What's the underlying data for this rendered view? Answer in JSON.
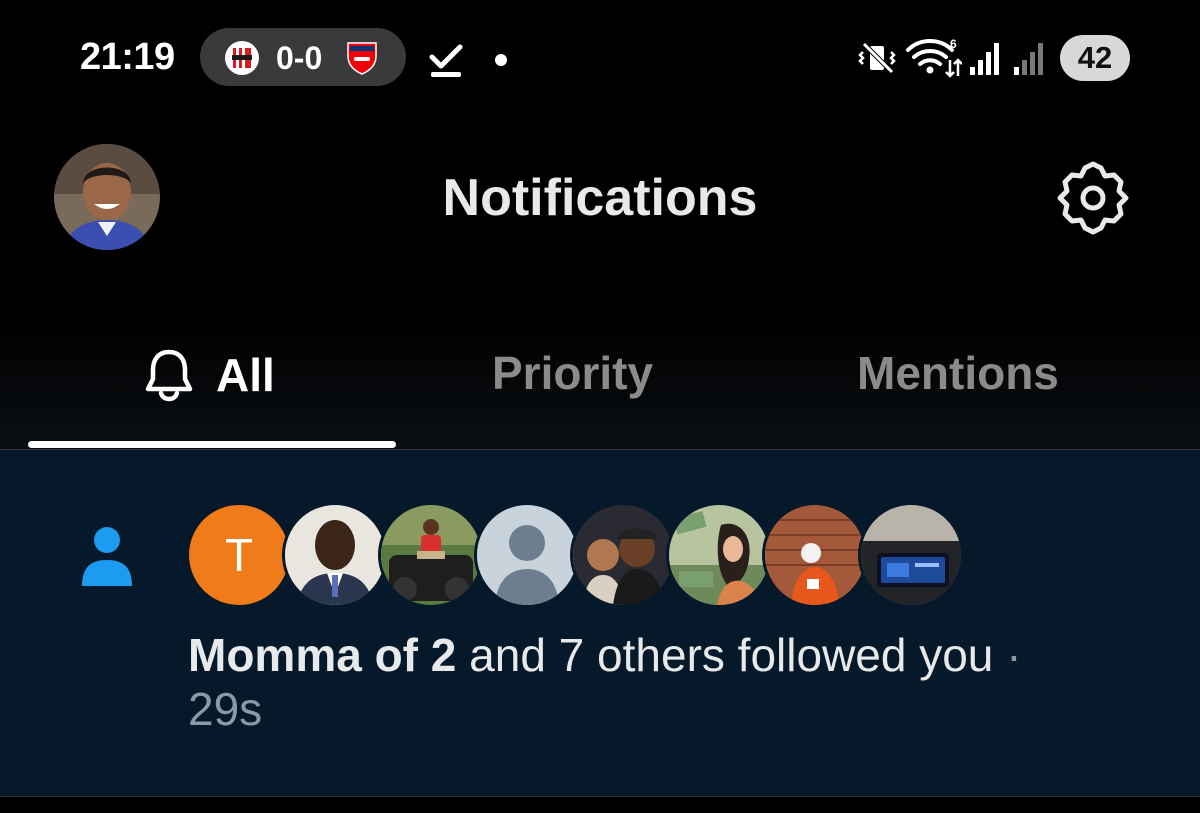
{
  "status_bar": {
    "time": "21:19",
    "score": "0-0",
    "battery": "42"
  },
  "header": {
    "title": "Notifications"
  },
  "tabs": [
    {
      "label": "All",
      "active": true
    },
    {
      "label": "Priority",
      "active": false
    },
    {
      "label": "Mentions",
      "active": false
    }
  ],
  "notification": {
    "icon": "person-icon",
    "avatar_letter": "T",
    "name": "Momma of 2",
    "message": "and 7 others followed you",
    "separator": "·",
    "time": "29s"
  },
  "colors": {
    "background": "#000000",
    "notification_bg": "#06192a",
    "accent_blue": "#1d9bf0",
    "avatar_orange": "#f07b1a",
    "muted_text": "#8b98a5"
  }
}
